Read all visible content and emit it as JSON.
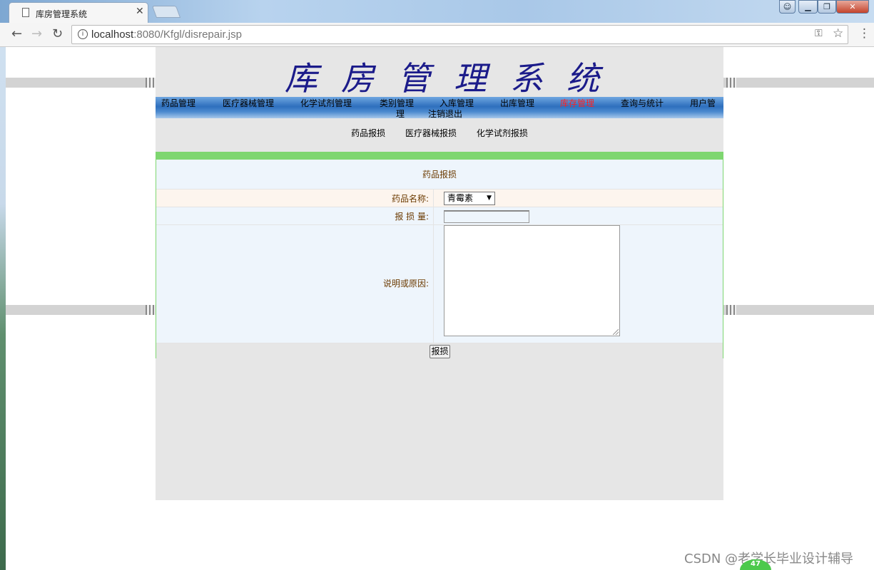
{
  "browser": {
    "tab_title": "库房管理系统",
    "tab_close": "✕",
    "url_host": "localhost",
    "url_path": ":8080/Kfgl/disrepair.jsp",
    "window_buttons": {
      "min": "▁",
      "max": "❐",
      "close": "✕"
    }
  },
  "banner": {
    "title": "库房管理系统"
  },
  "main_nav": [
    {
      "label": "药品管理"
    },
    {
      "label": "医疗器械管理"
    },
    {
      "label": "化学试剂管理"
    },
    {
      "label": "类别管理"
    },
    {
      "label": "入库管理"
    },
    {
      "label": "出库管理"
    },
    {
      "label": "库存管理"
    },
    {
      "label": "查询与统计"
    },
    {
      "label": "用户管"
    },
    {
      "label": "理"
    },
    {
      "label": "注销退出"
    }
  ],
  "sub_nav": [
    {
      "label": "药品报损"
    },
    {
      "label": "医疗器械报损"
    },
    {
      "label": "化学试剂报损"
    }
  ],
  "form": {
    "title": "药品报损",
    "name_label": "药品名称:",
    "name_value": "青霉素",
    "qty_label": "报 损 量:",
    "qty_value": "",
    "reason_label": "说明或原因:",
    "reason_value": "",
    "submit_label": "报损"
  },
  "watermark": "CSDN @老学长毕业设计辅导",
  "badge": "47",
  "colors": {
    "nav_active": "#ff2020",
    "form_border": "#7ed670",
    "label_text": "#6b3a00",
    "banner_title": "#1b1b8a"
  }
}
